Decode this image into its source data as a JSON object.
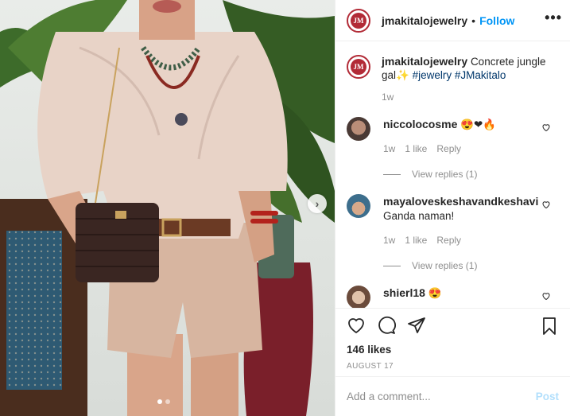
{
  "post": {
    "author": "jmakitalojewelry",
    "separator": "•",
    "follow_label": "Follow",
    "more_label": "•••",
    "avatar_text": "JM",
    "caption_plain": "Concrete jungle gal",
    "caption_emoji": "✨",
    "hashtags": [
      "#jewelry",
      "#JMakitalo"
    ],
    "caption_time": "1w",
    "next_icon": "›"
  },
  "comments": [
    {
      "user": "niccolocosme",
      "text": "😍❤🔥",
      "time": "1w",
      "likes": "1 like",
      "reply": "Reply",
      "view_replies": "View replies (1)"
    },
    {
      "user": "mayaloveskeshavandkeshavi",
      "text": "Ganda naman!",
      "time": "1w",
      "likes": "1 like",
      "reply": "Reply",
      "view_replies": "View replies (1)"
    },
    {
      "user": "shierl18",
      "text": "😍"
    }
  ],
  "stats": {
    "likes": "146 likes",
    "date": "AUGUST 17"
  },
  "composer": {
    "placeholder": "Add a comment...",
    "post_label": "Post"
  },
  "colors": {
    "link": "#0095f6",
    "hashtag": "#00376b",
    "brand": "#b22b37"
  }
}
